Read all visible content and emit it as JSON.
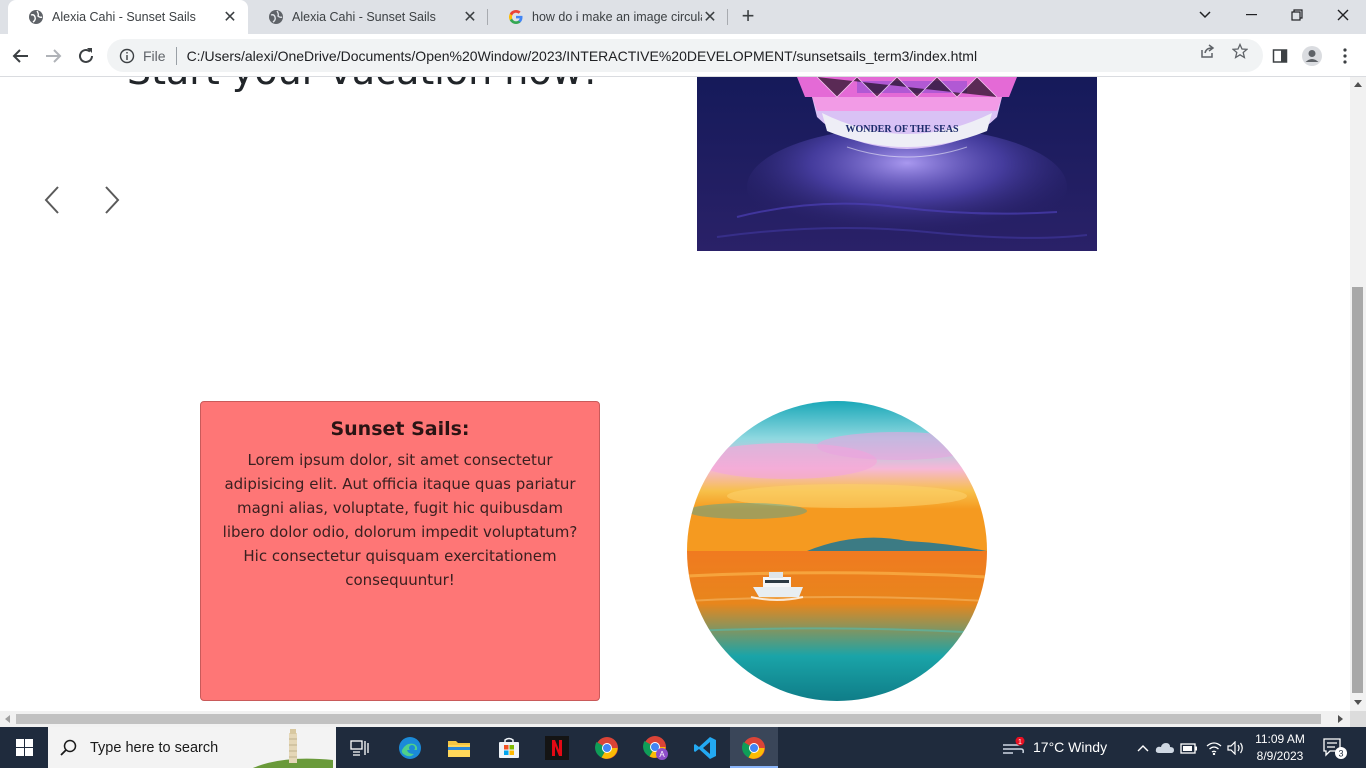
{
  "browser": {
    "tabs": [
      {
        "title": "Alexia Cahi - Sunset Sails",
        "active": true
      },
      {
        "title": "Alexia Cahi - Sunset Sails",
        "active": false
      },
      {
        "title": "how do i make an image circular",
        "active": false
      }
    ],
    "url_scheme": "File",
    "url": "C:/Users/alexi/OneDrive/Documents/Open%20Window/2023/INTERACTIVE%20DEVELOPMENT/sunsetsails_term3/index.html"
  },
  "page": {
    "hero_heading": "Start your vacation now!",
    "ship_name": "WONDER OF THE SEAS",
    "card": {
      "title": "Sunset Sails:",
      "body": "Lorem ipsum dolor, sit amet consectetur adipisicing elit. Aut officia itaque quas pariatur magni alias, voluptate, fugit hic quibusdam libero dolor odio, dolorum impedit voluptatum? Hic consectetur quisquam exercitationem consequuntur!"
    },
    "colors": {
      "card_bg": "#fe7676"
    }
  },
  "taskbar": {
    "search_placeholder": "Type here to search",
    "weather_badge": "1",
    "weather": "17°C  Windy",
    "time": "11:09 AM",
    "date": "8/9/2023",
    "notifications": "3"
  }
}
